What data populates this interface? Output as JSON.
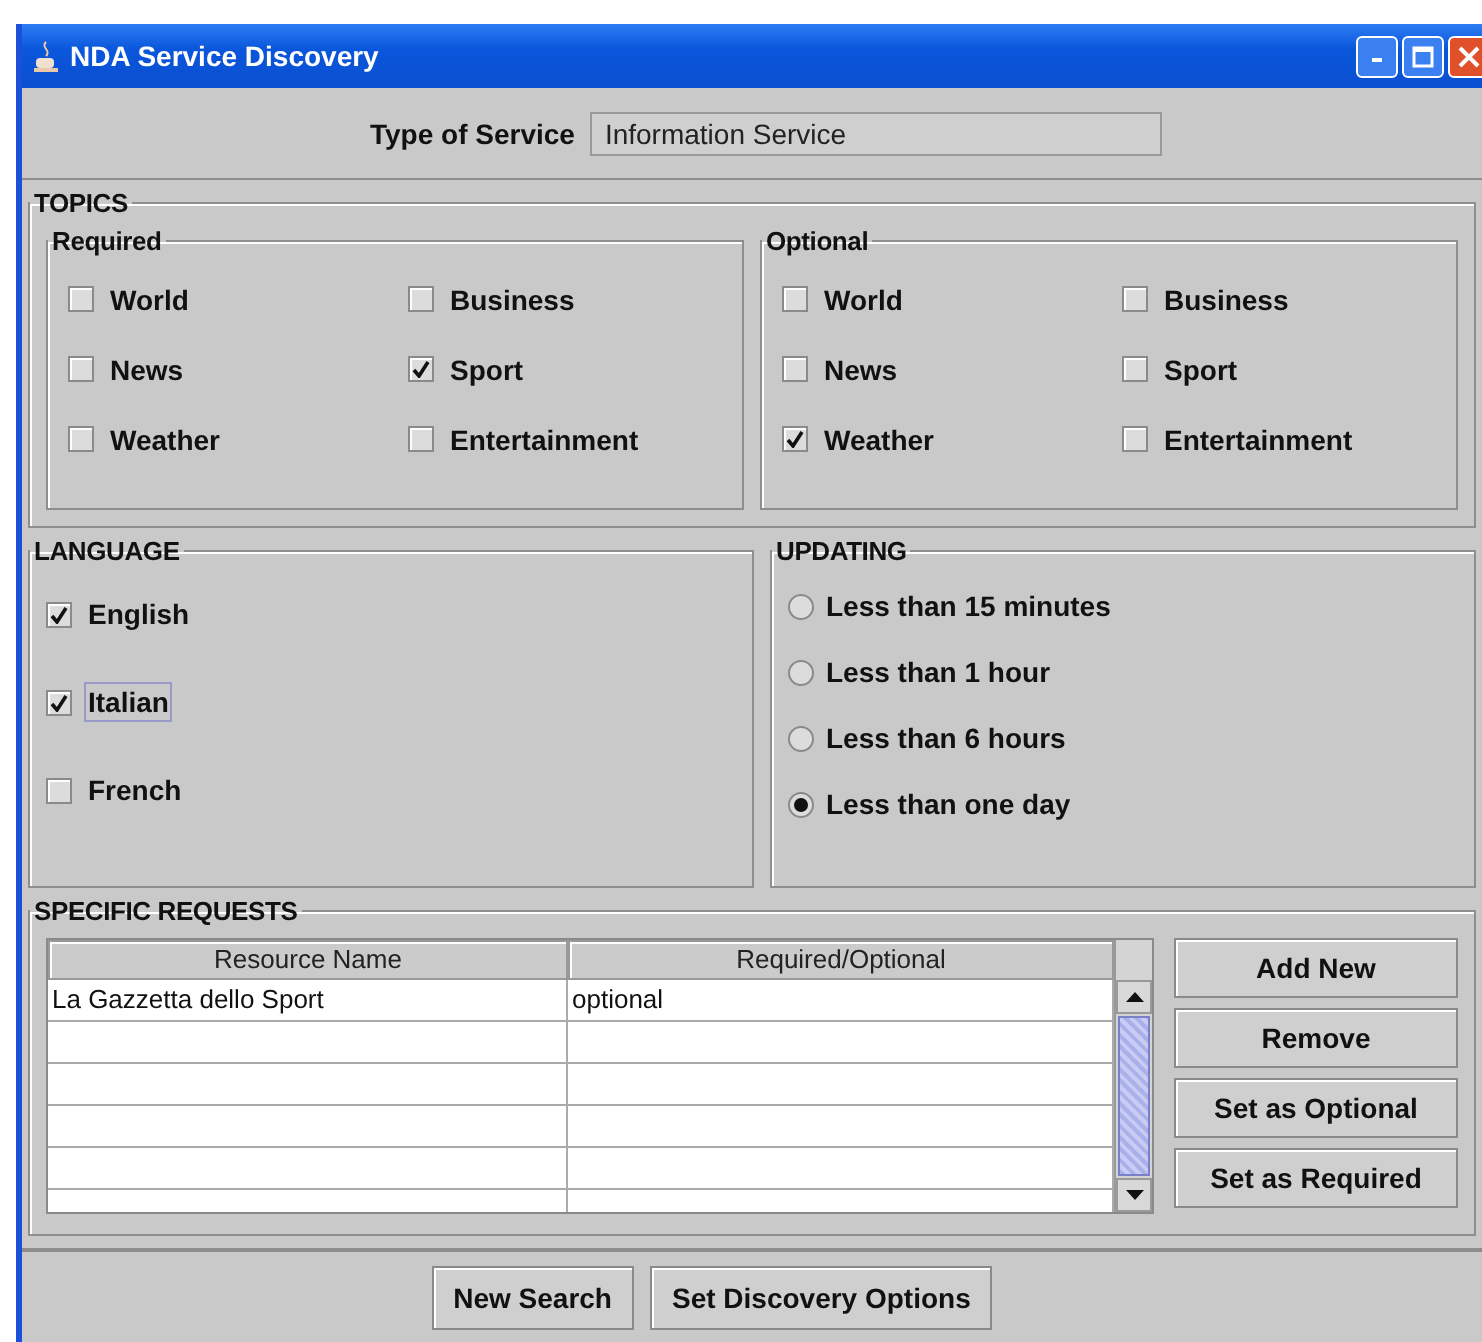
{
  "window": {
    "title": "NDA Service Discovery"
  },
  "service_type": {
    "label": "Type of Service",
    "value": "Information Service"
  },
  "topics": {
    "title": "TOPICS",
    "groups": [
      {
        "title": "Required",
        "items": [
          {
            "label": "World",
            "checked": false
          },
          {
            "label": "Business",
            "checked": false
          },
          {
            "label": "News",
            "checked": false
          },
          {
            "label": "Sport",
            "checked": true
          },
          {
            "label": "Weather",
            "checked": false
          },
          {
            "label": "Entertainment",
            "checked": false
          }
        ]
      },
      {
        "title": "Optional",
        "items": [
          {
            "label": "World",
            "checked": false
          },
          {
            "label": "Business",
            "checked": false
          },
          {
            "label": "News",
            "checked": false
          },
          {
            "label": "Sport",
            "checked": false
          },
          {
            "label": "Weather",
            "checked": true
          },
          {
            "label": "Entertainment",
            "checked": false
          }
        ]
      }
    ]
  },
  "language": {
    "title": "LANGUAGE",
    "items": [
      {
        "label": "English",
        "checked": true,
        "focused": false
      },
      {
        "label": "Italian",
        "checked": true,
        "focused": true
      },
      {
        "label": "French",
        "checked": false,
        "focused": false
      }
    ]
  },
  "updating": {
    "title": "UPDATING",
    "options": [
      {
        "label": "Less than 15 minutes",
        "selected": false
      },
      {
        "label": "Less than 1 hour",
        "selected": false
      },
      {
        "label": "Less than 6 hours",
        "selected": false
      },
      {
        "label": "Less than one day",
        "selected": true
      }
    ]
  },
  "specific_requests": {
    "title": "SPECIFIC REQUESTS",
    "table": {
      "columns": [
        "Resource Name",
        "Required/Optional"
      ],
      "rows": [
        [
          "La Gazzetta dello Sport",
          "optional"
        ]
      ]
    },
    "buttons": [
      "Add New",
      "Remove",
      "Set as Optional",
      "Set as Required"
    ]
  },
  "footer_buttons": [
    "New Search",
    "Set Discovery Options"
  ]
}
